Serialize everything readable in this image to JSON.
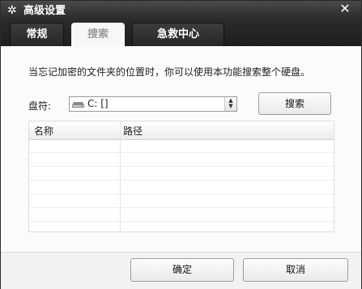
{
  "window": {
    "title": "高级设置",
    "close_glyph": "✕"
  },
  "tabs": [
    {
      "label": "常规"
    },
    {
      "label": "搜索"
    },
    {
      "label": "急救中心"
    }
  ],
  "search": {
    "description": "当忘记加密的文件夹的位置时，你可以使用本功能搜索整个硬盘。",
    "drive_label": "盘符:",
    "drive_value": "C: []",
    "search_button": "搜索",
    "table": {
      "columns": [
        "名称",
        "路径"
      ],
      "rows": []
    }
  },
  "footer": {
    "ok": "确定",
    "cancel": "取消"
  },
  "icons": {
    "title": "gear-icon",
    "drive": "hard-drive-icon",
    "close": "close-icon"
  }
}
